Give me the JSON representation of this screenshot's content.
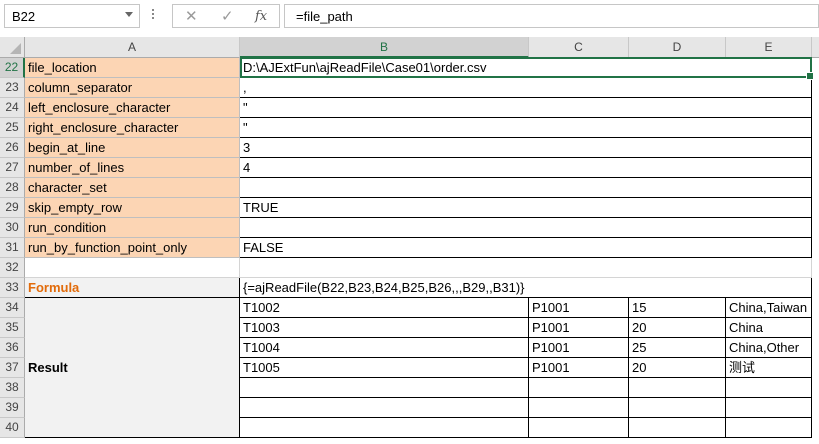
{
  "formula_bar": {
    "name_box": "B22",
    "formula": "=file_path",
    "cancel_glyph": "✕",
    "enter_glyph": "✓",
    "fx_glyph": "fx"
  },
  "columns": [
    "A",
    "B",
    "C",
    "D",
    "E"
  ],
  "rows": [
    "22",
    "23",
    "24",
    "25",
    "26",
    "27",
    "28",
    "29",
    "30",
    "31",
    "32",
    "33",
    "34",
    "35",
    "36",
    "37",
    "38",
    "39",
    "40"
  ],
  "params": [
    {
      "label": "file_location",
      "value": "D:\\AJExtFun\\ajReadFile\\Case01\\order.csv"
    },
    {
      "label": "column_separator",
      "value": ","
    },
    {
      "label": "left_enclosure_character",
      "value": "\""
    },
    {
      "label": "right_enclosure_character",
      "value": "\""
    },
    {
      "label": "begin_at_line",
      "value": "3"
    },
    {
      "label": "number_of_lines",
      "value": "4"
    },
    {
      "label": "character_set",
      "value": ""
    },
    {
      "label": "skip_empty_row",
      "value": "TRUE"
    },
    {
      "label": "run_condition",
      "value": ""
    },
    {
      "label": "run_by_function_point_only",
      "value": "FALSE"
    }
  ],
  "formula_row": {
    "label": "Formula",
    "value": "{=ajReadFile(B22,B23,B24,B25,B26,,,B29,,B31)}"
  },
  "result_label": "Result",
  "results": [
    [
      "T1002",
      "P1001",
      "15",
      "China,Taiwan"
    ],
    [
      "T1003",
      "P1001",
      "20",
      "China"
    ],
    [
      "T1004",
      "P1001",
      "25",
      "China,Other"
    ],
    [
      "T1005",
      "P1001",
      "20",
      "测试"
    ]
  ],
  "colors": {
    "label_fill": "#fcd5b4",
    "accent": "#217346",
    "formula_label": "#e26b0a"
  }
}
